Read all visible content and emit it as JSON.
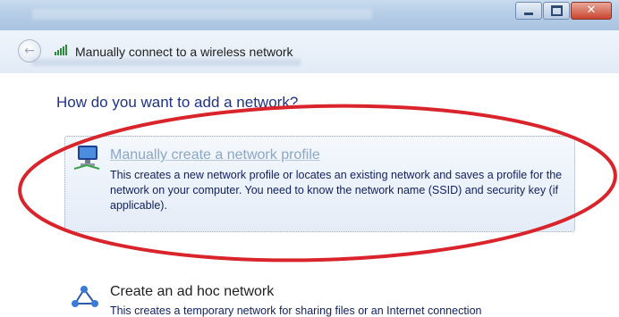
{
  "window": {
    "title_bar_icons": [
      "minimize-icon",
      "maximize-icon",
      "close-icon"
    ]
  },
  "nav": {
    "title": "Manually connect to a wireless network",
    "back_icon": "back-arrow-icon",
    "signal_icon": "wireless-signal-icon"
  },
  "main": {
    "heading": "How do you want to add a network?",
    "options": [
      {
        "title": "Manually create a network profile",
        "description": "This creates a new network profile or locates an existing network and saves a profile for the network on your computer. You need to know the network name (SSID) and security key (if applicable).",
        "icon": "network-computer-icon",
        "highlighted": true
      },
      {
        "title": "Create an ad hoc network",
        "description": "This creates a temporary network for sharing files or an Internet connection",
        "icon": "ad-hoc-network-icon"
      }
    ]
  },
  "annotation": {
    "color": "#d8242a",
    "shape": "ellipse"
  }
}
